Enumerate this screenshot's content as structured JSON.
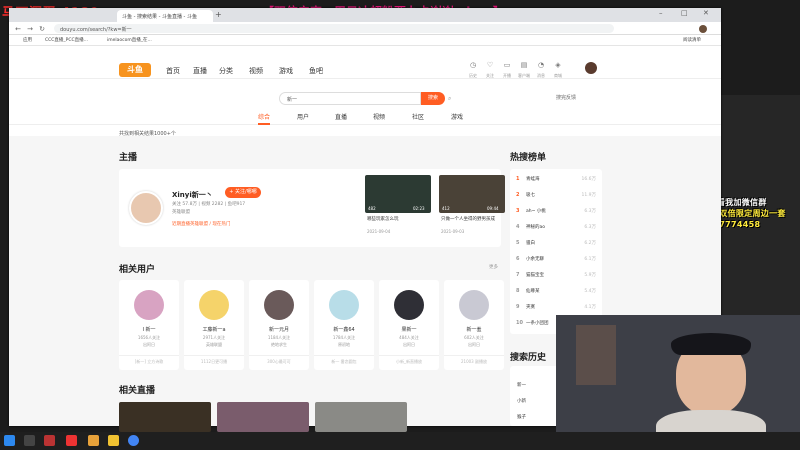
{
  "overlay": {
    "streamer": "马丁浑蛋 4180",
    "banner": "【双倍亲密，周日冲超粉要办卡谢谢xdm~】",
    "promo_lines": [
      "1238粉丝群第5群看我加微信群",
      "赠送礼物6888鱼丸双倍限定周边一套",
      "主播QQ群号：1107774458"
    ]
  },
  "browser": {
    "tabs": [
      {
        "label": "斗鱼 - 搜索结果 - 斗鱼直播 - 斗鱼",
        "active": true
      }
    ],
    "url": "douyu.com/search/?kw=新一",
    "bookmarks": [
      "应用",
      "CCC直播_PCC直播...",
      "imelaocom直播_在..."
    ],
    "reading_list": "阅读清单"
  },
  "douyu": {
    "logo": "斗鱼",
    "nav": [
      "首页",
      "直播",
      "分类",
      "视频",
      "游戏",
      "鱼吧"
    ],
    "top_icons": [
      {
        "icon": "history-icon",
        "label": "历史"
      },
      {
        "icon": "heart-icon",
        "label": "关注"
      },
      {
        "icon": "open-icon",
        "label": "开播"
      },
      {
        "icon": "client-icon",
        "label": "客户端"
      },
      {
        "icon": "bell-icon",
        "label": "消息"
      },
      {
        "icon": "shop-icon",
        "label": "商城"
      }
    ],
    "search_value": "新一",
    "search_button": "搜索",
    "suggest": "搜完反馈",
    "search_tabs": [
      "综合",
      "用户",
      "直播",
      "视频",
      "社区",
      "游戏"
    ],
    "result_count": "共找到相关结果1000+个"
  },
  "anchor_section": {
    "title": "主播",
    "name": "Xinyi新一丶",
    "follow": "+ 关注/哪哪",
    "stats": "关注 57.8万 | 视频 2282 | 鱼吧917",
    "category": "英雄联盟",
    "rec": "近期直播英雄联盟 / 现在热门",
    "videos": [
      {
        "title": "哪些玩家怎么玩",
        "count": "482",
        "duration": "02:23",
        "date": "2021-09-04"
      },
      {
        "title": "只做一个人坐得的野男孩成",
        "count": "412",
        "duration": "09:44",
        "date": "2021-09-03"
      }
    ]
  },
  "hot": {
    "title": "热搜榜单",
    "items": [
      {
        "rank": "1",
        "name": "青蛙海",
        "val": "16.6万"
      },
      {
        "rank": "2",
        "name": "吸七",
        "val": "11.9万"
      },
      {
        "rank": "3",
        "name": "ah~ 小桃",
        "val": "6.3万"
      },
      {
        "rank": "4",
        "name": "神秘的ao",
        "val": "6.3万"
      },
      {
        "rank": "5",
        "name": "骚白",
        "val": "6.2万"
      },
      {
        "rank": "6",
        "name": "小余无聊",
        "val": "6.1万"
      },
      {
        "rank": "7",
        "name": "猫猫宝宝",
        "val": "5.9万"
      },
      {
        "rank": "8",
        "name": "仙尊某",
        "val": "5.4万"
      },
      {
        "rank": "9",
        "name": "夹寞",
        "val": "4.1万"
      },
      {
        "rank": "10",
        "name": "一条小团团",
        "val": ""
      }
    ]
  },
  "users_section": {
    "title": "相关用户",
    "more": "更多",
    "users": [
      {
        "name": "I 新一",
        "l1": "1656人关注",
        "l2": "出阿日",
        "l3": "[新一] 立方诗歌",
        "color": "#d8a3c2"
      },
      {
        "name": "工藤新一a",
        "l1": "2971人关注",
        "l2": "英雄联盟",
        "l3": "1112日更可播",
        "color": "#f5d36a"
      },
      {
        "name": "新一元月",
        "l1": "1184人关注",
        "l2": "绝地求生",
        "l3": "300心最可可",
        "color": "#6a5a5a"
      },
      {
        "name": "新一鑫64",
        "l1": "1784人关注",
        "l2": "原初地",
        "l3": "新一 番恋圆包",
        "color": "#b8dde8"
      },
      {
        "name": "果新一",
        "l1": "484人关注",
        "l2": "出阿日",
        "l3": "小新_新直播放",
        "color": "#2f2f36"
      },
      {
        "name": "新一羞",
        "l1": "602人关注",
        "l2": "出阿日",
        "l3": "21003 副播放",
        "color": "#c9c9d3"
      }
    ]
  },
  "history": {
    "title": "搜索历史",
    "items": [
      "新一",
      "小新",
      "猴子"
    ]
  },
  "live_section": {
    "title": "相关直播"
  }
}
